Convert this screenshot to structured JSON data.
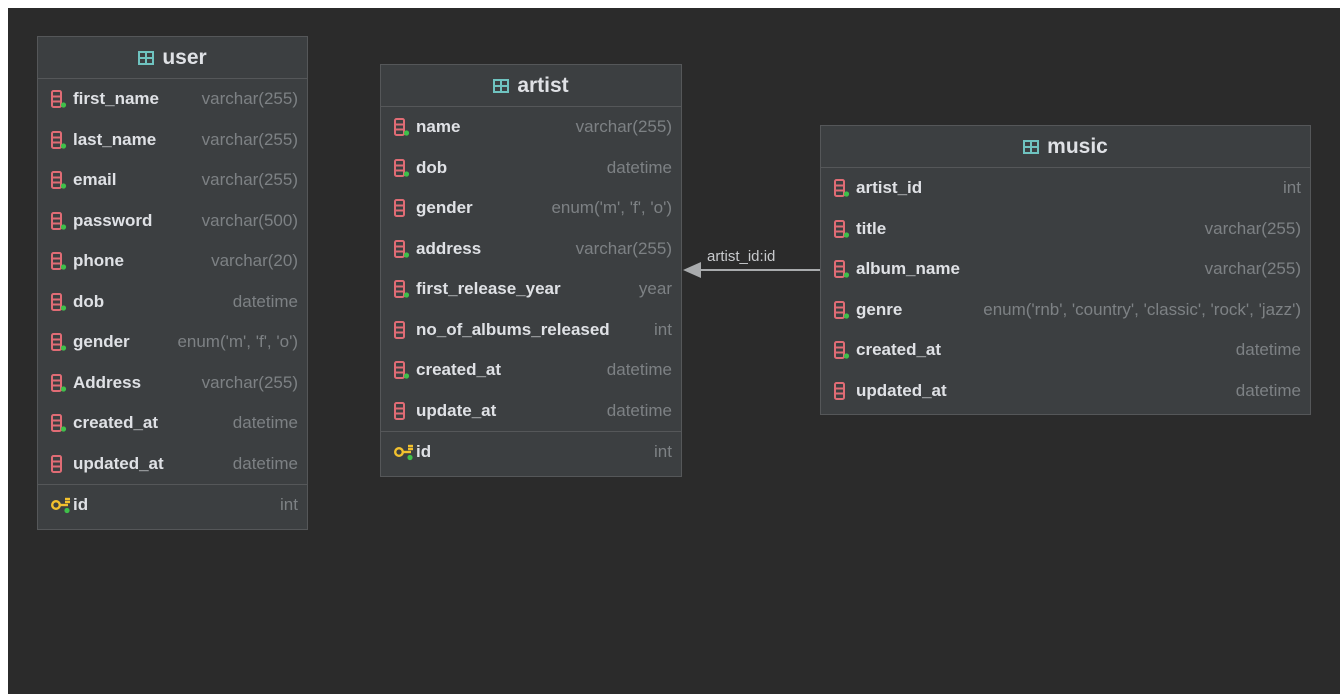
{
  "tables": {
    "user": {
      "name": "user",
      "columns": [
        {
          "name": "first_name",
          "type": "varchar(255)",
          "not_null": true
        },
        {
          "name": "last_name",
          "type": "varchar(255)",
          "not_null": true
        },
        {
          "name": "email",
          "type": "varchar(255)",
          "not_null": true
        },
        {
          "name": "password",
          "type": "varchar(500)",
          "not_null": true
        },
        {
          "name": "phone",
          "type": "varchar(20)",
          "not_null": true
        },
        {
          "name": "dob",
          "type": "datetime",
          "not_null": true
        },
        {
          "name": "gender",
          "type": "enum('m', 'f', 'o')",
          "not_null": true
        },
        {
          "name": "Address",
          "type": "varchar(255)",
          "not_null": true
        },
        {
          "name": "created_at",
          "type": "datetime",
          "not_null": true
        },
        {
          "name": "updated_at",
          "type": "datetime",
          "not_null": false
        }
      ],
      "pk": {
        "name": "id",
        "type": "int"
      }
    },
    "artist": {
      "name": "artist",
      "columns": [
        {
          "name": "name",
          "type": "varchar(255)",
          "not_null": true
        },
        {
          "name": "dob",
          "type": "datetime",
          "not_null": true
        },
        {
          "name": "gender",
          "type": "enum('m', 'f', 'o')",
          "not_null": false
        },
        {
          "name": "address",
          "type": "varchar(255)",
          "not_null": true
        },
        {
          "name": "first_release_year",
          "type": "year",
          "not_null": true
        },
        {
          "name": "no_of_albums_released",
          "type": "int",
          "not_null": false
        },
        {
          "name": "created_at",
          "type": "datetime",
          "not_null": true
        },
        {
          "name": "update_at",
          "type": "datetime",
          "not_null": false
        }
      ],
      "pk": {
        "name": "id",
        "type": "int"
      }
    },
    "music": {
      "name": "music",
      "columns": [
        {
          "name": "artist_id",
          "type": "int",
          "not_null": true
        },
        {
          "name": "title",
          "type": "varchar(255)",
          "not_null": true
        },
        {
          "name": "album_name",
          "type": "varchar(255)",
          "not_null": true
        },
        {
          "name": "genre",
          "type": "enum('rnb', 'country', 'classic', 'rock', 'jazz')",
          "not_null": true
        },
        {
          "name": "created_at",
          "type": "datetime",
          "not_null": true
        },
        {
          "name": "updated_at",
          "type": "datetime",
          "not_null": false
        }
      ]
    }
  },
  "relationship": {
    "label": "artist_id:id",
    "from": "music",
    "to": "artist"
  },
  "colors": {
    "canvas": "#2b2b2b",
    "table_bg": "#3c3f41",
    "border": "#555759",
    "column_icon": "#e06c75",
    "not_null_dot": "#3fc04a",
    "key_icon": "#f2c12e",
    "table_icon": "#6fc3c0",
    "name_text": "#dfe1e5",
    "type_text": "#7d8184",
    "edge": "#a9abad"
  },
  "icons": {
    "table": "table-grid-icon",
    "column": "column-icon",
    "primary_key": "primary-key-icon"
  }
}
